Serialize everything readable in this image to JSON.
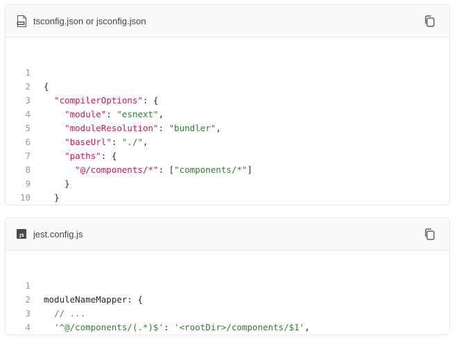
{
  "blocks": [
    {
      "filename": "tsconfig.json or jsconfig.json",
      "file_icon": "json-file-icon",
      "copy_icon": "copy-icon",
      "lines": [
        {
          "n": "1"
        },
        {
          "n": "2"
        },
        {
          "n": "3"
        },
        {
          "n": "4"
        },
        {
          "n": "5"
        },
        {
          "n": "6"
        },
        {
          "n": "7"
        },
        {
          "n": "8"
        },
        {
          "n": "9"
        },
        {
          "n": "10"
        }
      ],
      "tokens": {
        "l1": "{",
        "l2_key": "\"compilerOptions\"",
        "l2_rest": ": {",
        "l3_key": "\"module\"",
        "l3_sep": ": ",
        "l3_val": "\"esnext\"",
        "l3_end": ",",
        "l4_key": "\"moduleResolution\"",
        "l4_sep": ": ",
        "l4_val": "\"bundler\"",
        "l4_end": ",",
        "l5_key": "\"baseUrl\"",
        "l5_sep": ": ",
        "l5_val": "\"./\"",
        "l5_end": ",",
        "l6_key": "\"paths\"",
        "l6_rest": ": {",
        "l7_key": "\"@/components/*\"",
        "l7_sep": ": [",
        "l7_val": "\"components/*\"",
        "l7_end": "]",
        "l8": "}",
        "l9": "}",
        "l10": "}"
      }
    },
    {
      "filename": "jest.config.js",
      "file_icon": "js-file-icon",
      "copy_icon": "copy-icon",
      "badge": "JS",
      "lines": [
        {
          "n": "1"
        },
        {
          "n": "2"
        },
        {
          "n": "3"
        },
        {
          "n": "4"
        }
      ],
      "tokens": {
        "l1": "moduleNameMapper: {",
        "l2": "// ...",
        "l3_key": "'^@/components/(.*)$'",
        "l3_sep": ": ",
        "l3_val": "'<rootDir>/components/$1'",
        "l3_end": ",",
        "l4": "}"
      }
    }
  ]
}
